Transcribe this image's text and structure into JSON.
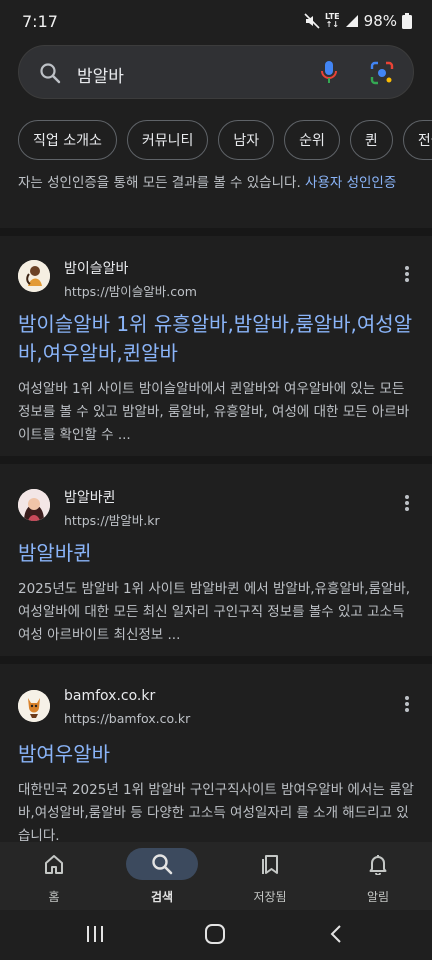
{
  "status": {
    "time": "7:17",
    "network": "LTE",
    "battery": "98%"
  },
  "search": {
    "query": "밤알바",
    "icons": [
      "search-icon",
      "mic-icon",
      "lens-icon"
    ]
  },
  "chips": [
    "직업 소개소",
    "커뮤니티",
    "남자",
    "순위",
    "퀸",
    "전국 밤"
  ],
  "notice": {
    "text": "자는 성인인증을 통해 모든 결과를 볼 수 있습니다.",
    "link": "사용자 성인인증"
  },
  "results": [
    {
      "site_name": "밤이슬알바",
      "url": "https://밤이슬알바.com",
      "title": "밤이슬알바 1위 유흥알바,밤알바,룸알바,여성알바,여우알바,퀸알바",
      "snippet": "여성알바 1위 사이트 밤이슬알바에서 퀸알바와 여우알바에 있는 모든 정보를 볼 수 있고 밤알바, 룸알바, 유흥알바, 여성에 대한 모든 아르바이트를 확인할 수 ..."
    },
    {
      "site_name": "밤알바퀸",
      "url": "https://밤알바.kr",
      "title": "밤알바퀸",
      "snippet": "2025년도 밤알바 1위 사이트 밤알바퀸 에서 밤알바,유흥알바,룸알바,여성알바에 대한 모든 최신 일자리 구인구직 정보를 볼수 있고 고소득 여성 아르바이트 최신정보 ..."
    },
    {
      "site_name": "bamfox.co.kr",
      "url": "https://bamfox.co.kr",
      "title": "밤여우알바",
      "snippet": "대한민국 2025년 1위 밤알바 구인구직사이트 밤여우알바 에서는 룸알바,여성알바,룸알바 등 다양한 고소득 여성일자리 를 소개 해드리고 있습니다."
    }
  ],
  "bottom_nav": [
    {
      "label": "홈",
      "icon": "home-icon",
      "active": false
    },
    {
      "label": "검색",
      "icon": "search-icon",
      "active": true
    },
    {
      "label": "저장됨",
      "icon": "saved-icon",
      "active": false
    },
    {
      "label": "알림",
      "icon": "bell-icon",
      "active": false
    }
  ],
  "colors": {
    "background": "#1f1f1f",
    "link": "#8ab4f8",
    "active_nav": "#3c4a5e"
  }
}
